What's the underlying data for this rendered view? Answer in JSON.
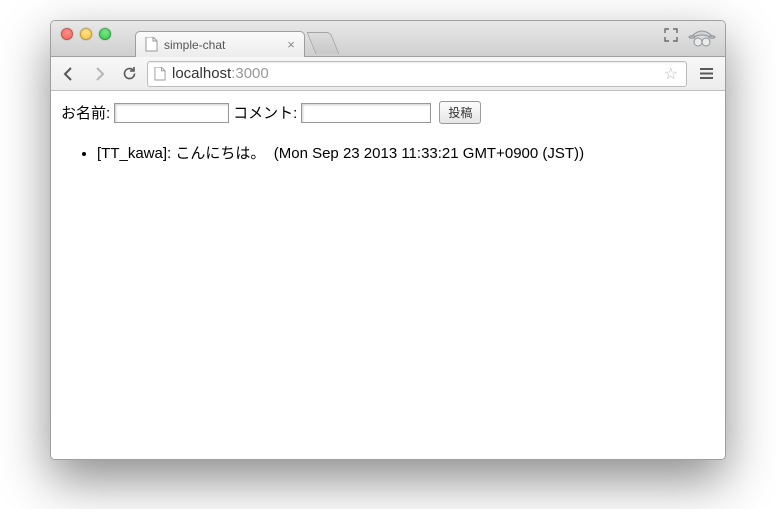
{
  "window": {
    "tab_title": "simple-chat",
    "url_host": "localhost",
    "url_port": ":3000"
  },
  "form": {
    "name_label": "お名前:",
    "name_value": "",
    "comment_label": "コメント:",
    "comment_value": "",
    "submit_label": "投稿"
  },
  "messages": [
    {
      "user": "TT_kawa",
      "text": "こんにちは。",
      "timestamp": "Mon Sep 23 2013 11:33:21 GMT+0900 (JST)"
    }
  ]
}
